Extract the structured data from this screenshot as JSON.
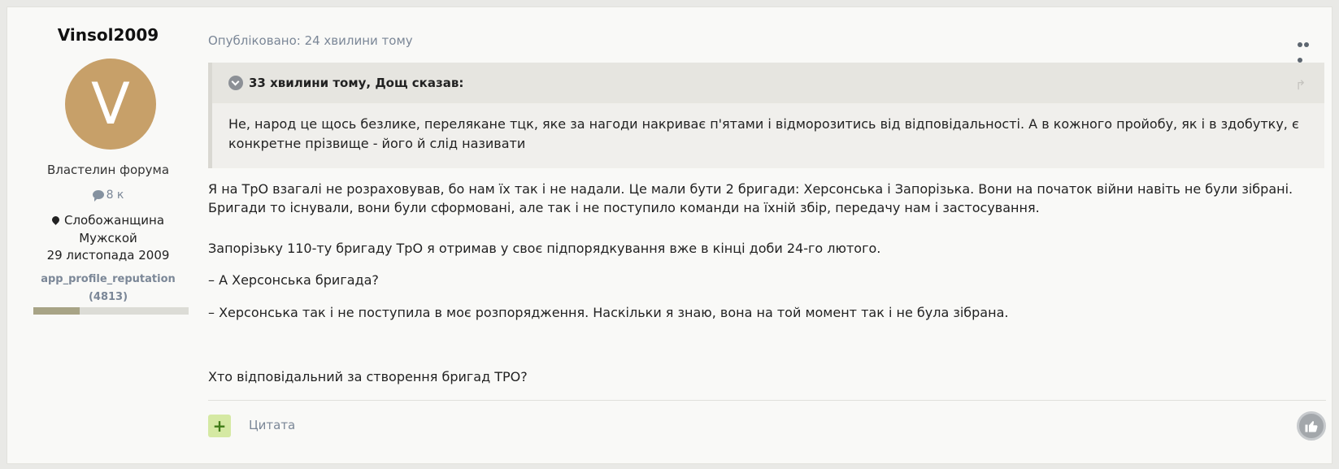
{
  "author": {
    "name": "Vinsol2009",
    "avatar_letter": "V",
    "avatar_color": "#c7a069",
    "rank": "Властелин форума",
    "posts_icon": "comment-icon",
    "posts_count": "8 к",
    "location_icon": "map-pin-icon",
    "location": "Слобожанщина",
    "gender": "Мужской",
    "joined": "29 листопада 2009",
    "reputation_label": "app_profile_reputation",
    "reputation_value": "(4813)",
    "reputation_fill_fraction": 0.3
  },
  "post": {
    "published": "Опубліковано: 24 хвилини тому",
    "quote": {
      "header": "33 хвилини тому, Дощ сказав:",
      "text": "Не, народ це щось безлике, перелякане тцк, яке за нагоди накриває п'ятами і відморозитись від відповідальності. А в кожного пройобу, як і в здобутку, є конкретне прізвище - його й слід називати"
    },
    "paragraphs": [
      "Я на ТрО взагалі не розраховував, бо нам їх так і не надали. Це мали бути 2 бригади: Херсонська і Запорізька. Вони на початок війни навіть не були зібрані. Бригади то існували, вони були сформовані, але так і не поступило команди на їхній збір, передачу нам і застосування.",
      "Запорізьку 110-ту бригаду ТрО я отримав у своє підпорядкування вже в кінці доби 24-го лютого.",
      "– А Херсонська бригада?",
      "– Херсонська так і не поступила в моє розпорядження. Наскільки я знаю, вона на той момент так і не була зібрана.",
      "Хто відповідальний за створення бригад ТРО?"
    ],
    "footer": {
      "plus_label": "+",
      "quote_label": "Цитата"
    }
  }
}
